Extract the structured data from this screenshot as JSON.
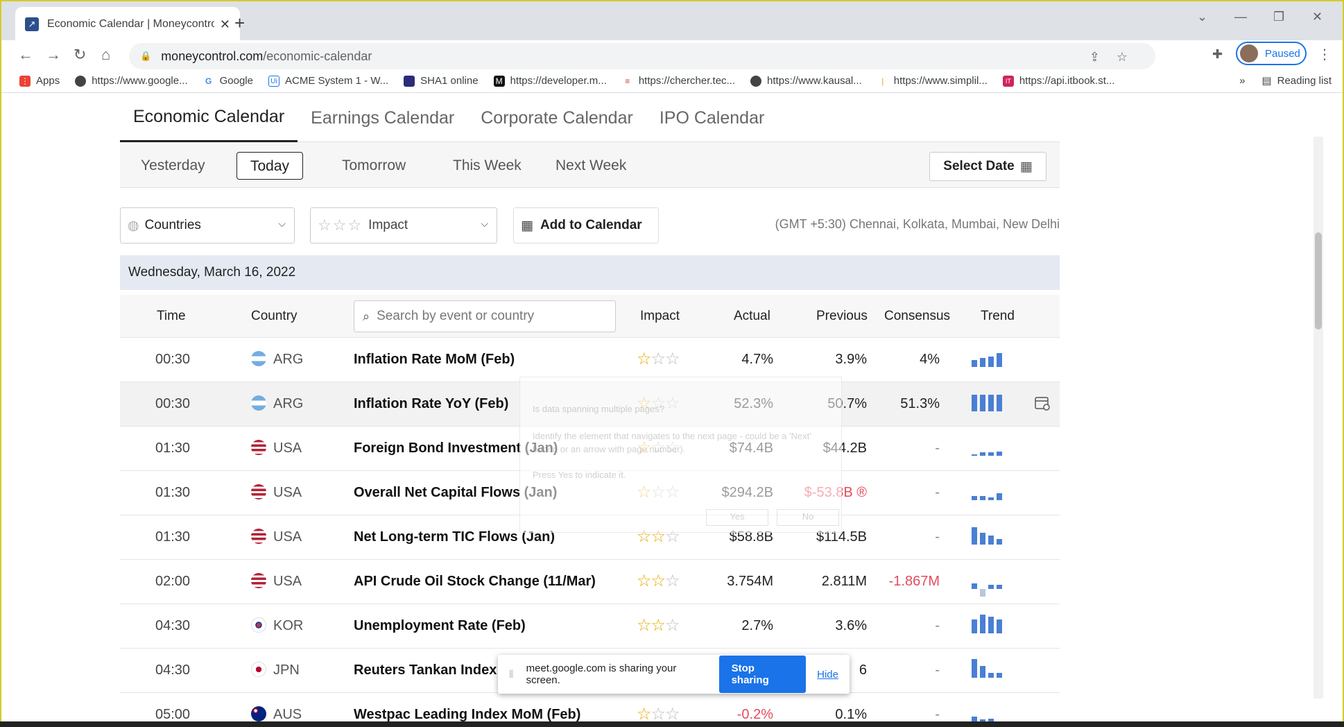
{
  "browser": {
    "tab_title": "Economic Calendar | Moneycontrol",
    "url_host": "moneycontrol.com",
    "url_path": "/economic-calendar",
    "profile_label": "Paused",
    "bookmarks": [
      {
        "label": "Apps",
        "icon": "apps-grid-icon",
        "color": "#ea4335"
      },
      {
        "label": "https://www.google...",
        "icon": "globe-icon",
        "color": "#444444"
      },
      {
        "label": "Google",
        "icon": "google-icon",
        "color": "#4285f4"
      },
      {
        "label": "ACME System 1 - W...",
        "icon": "uipath-icon",
        "color": "#1a73e8"
      },
      {
        "label": "SHA1 online",
        "icon": "sha1-icon",
        "color": "#2c2c7a"
      },
      {
        "label": "https://developer.m...",
        "icon": "m-icon",
        "color": "#111111"
      },
      {
        "label": "https://chercher.tec...",
        "icon": "chercher-icon",
        "color": "#c4453a"
      },
      {
        "label": "https://www.kausal...",
        "icon": "globe-icon",
        "color": "#444444"
      },
      {
        "label": "https://www.simplil...",
        "icon": "simplilearn-icon",
        "color": "#f0a020"
      },
      {
        "label": "https://api.itbook.st...",
        "icon": "itbook-icon",
        "color": "#d0245a"
      }
    ],
    "more_bookmarks": "»",
    "reading_list": "Reading list"
  },
  "calendar": {
    "main_tabs": [
      "Economic Calendar",
      "Earnings Calendar",
      "Corporate Calendar",
      "IPO Calendar"
    ],
    "day_tabs": [
      "Yesterday",
      "Today",
      "Tomorrow",
      "This Week",
      "Next Week"
    ],
    "active_day": "Today",
    "select_date": "Select Date",
    "countries_label": "Countries",
    "impact_label": "Impact",
    "add_to_calendar": "Add to Calendar",
    "timezone": "(GMT +5:30) Chennai, Kolkata, Mumbai, New Delhi",
    "date_header": "Wednesday, March 16, 2022",
    "columns": {
      "time": "Time",
      "country": "Country",
      "impact": "Impact",
      "actual": "Actual",
      "previous": "Previous",
      "consensus": "Consensus",
      "trend": "Trend"
    },
    "search_placeholder": "Search by event or country",
    "rows": [
      {
        "time": "00:30",
        "country": "ARG",
        "event": "Inflation Rate MoM (Feb)",
        "impact": 1,
        "actual": "4.7%",
        "previous": "3.9%",
        "consensus": "4%"
      },
      {
        "time": "00:30",
        "country": "ARG",
        "event": "Inflation Rate YoY (Feb)",
        "impact": 1,
        "actual": "52.3%",
        "previous": "50.7%",
        "consensus": "51.3%"
      },
      {
        "time": "01:30",
        "country": "USA",
        "event": "Foreign Bond Investment (Jan)",
        "impact": 1,
        "actual": "$74.4B",
        "previous": "$44.2B",
        "consensus": "-"
      },
      {
        "time": "01:30",
        "country": "USA",
        "event": "Overall Net Capital Flows (Jan)",
        "impact": 1,
        "actual": "$294.2B",
        "previous": "$-53.8B ®",
        "consensus": "-"
      },
      {
        "time": "01:30",
        "country": "USA",
        "event": "Net Long-term TIC Flows (Jan)",
        "impact": 2,
        "actual": "$58.8B",
        "previous": "$114.5B",
        "consensus": "-"
      },
      {
        "time": "02:00",
        "country": "USA",
        "event": "API Crude Oil Stock Change (11/Mar)",
        "impact": 2,
        "actual": "3.754M",
        "previous": "2.811M",
        "consensus": "-1.867M"
      },
      {
        "time": "04:30",
        "country": "KOR",
        "event": "Unemployment Rate (Feb)",
        "impact": 2,
        "actual": "2.7%",
        "previous": "3.6%",
        "consensus": "-"
      },
      {
        "time": "04:30",
        "country": "JPN",
        "event": "Reuters Tankan Index (",
        "impact": 1,
        "actual": "",
        "previous": "6",
        "consensus": "-"
      },
      {
        "time": "05:00",
        "country": "AUS",
        "event": "Westpac Leading Index MoM (Feb)",
        "impact": 1,
        "actual": "-0.2%",
        "previous": "0.1%",
        "consensus": "-"
      }
    ]
  },
  "share_bar": {
    "message": "meet.google.com is sharing your screen.",
    "stop": "Stop sharing",
    "hide": "Hide"
  },
  "ghost_dialog": {
    "title": "Is data spanning multiple pages?",
    "body": "Identify the element that navigates to the next page - could be a 'Next' button or an arrow with page number).",
    "hint": "Press Yes to indicate it.",
    "yes": "Yes",
    "no": "No"
  },
  "colors": {
    "accent": "#1a73e8",
    "trend_bar": "#4a7fd4",
    "negative": "#e44c5b",
    "star": "#e8a700"
  }
}
